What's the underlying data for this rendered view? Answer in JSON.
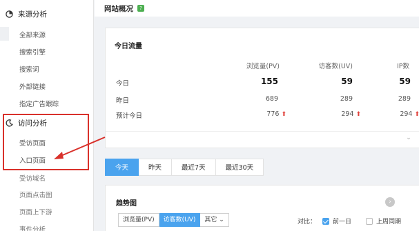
{
  "sidebar": {
    "source_section": {
      "label": "来源分析",
      "items": [
        "全部来源",
        "搜索引擎",
        "搜索词",
        "外部链接",
        "指定广告跟踪"
      ]
    },
    "visit_section": {
      "label": "访问分析",
      "items": [
        "受访页面",
        "入口页面",
        "受访域名",
        "页面点击图",
        "页面上下游",
        "事件分析"
      ]
    }
  },
  "header": {
    "title": "网站概况",
    "badge": "?"
  },
  "today_traffic": {
    "title": "今日流量",
    "columns": [
      "浏览量(PV)",
      "访客数(UV)",
      "IP数"
    ],
    "rows": [
      {
        "label": "今日",
        "values": [
          "155",
          "59",
          "59"
        ]
      },
      {
        "label": "昨日",
        "values": [
          "689",
          "289",
          "289"
        ]
      },
      {
        "label": "预计今日",
        "values": [
          "776",
          "294",
          "294"
        ]
      }
    ],
    "trend_up_glyph": "⬆",
    "expand_glyph": "⌄"
  },
  "range_tabs": [
    "今天",
    "昨天",
    "最近7天",
    "最近30天"
  ],
  "trend": {
    "title": "趋势图",
    "next_glyph": "›",
    "metrics": [
      "浏览量(PV)",
      "访客数(UV)",
      "其它 ⌄"
    ],
    "compare_label": "对比：",
    "compare_prev": "前一日",
    "compare_lastweek": "上周同期"
  },
  "colors": {
    "accent": "#4aa3ee",
    "annotation": "#d9312b",
    "up": "#e0403a"
  }
}
